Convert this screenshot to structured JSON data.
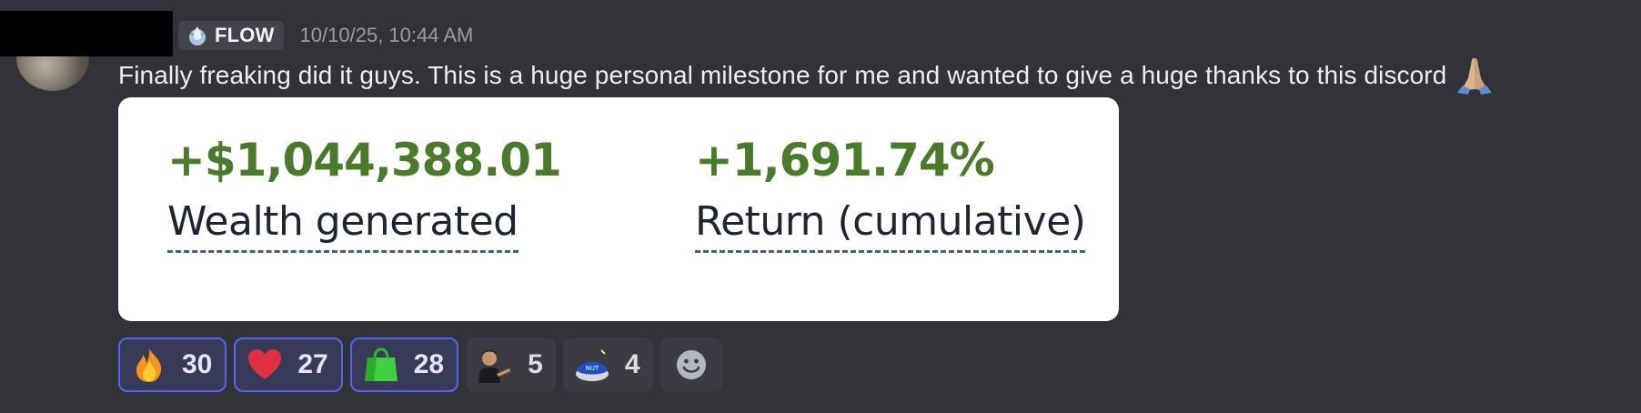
{
  "message": {
    "guild_tag": "FLOW",
    "timestamp": "10/10/25, 10:44 AM",
    "text": "Finally freaking did it guys.  This is a huge personal milestone for me and wanted to give a huge thanks to this discord",
    "trailing_emoji": "folded-hands-icon"
  },
  "card": {
    "left_value": "+$1,044,388.01",
    "left_label": "Wealth generated",
    "right_value": "+1,691.74%",
    "right_label": "Return (cumulative)",
    "value_color": "#4b7a2c"
  },
  "reactions": [
    {
      "emoji": "fire-icon",
      "count": "30",
      "active": true
    },
    {
      "emoji": "heart-icon",
      "count": "27",
      "active": true
    },
    {
      "emoji": "green-bag-icon",
      "count": "28",
      "active": true
    },
    {
      "emoji": "person-pointing-icon",
      "count": "5",
      "active": false
    },
    {
      "emoji": "nut-button-icon",
      "count": "4",
      "active": false
    }
  ],
  "colors": {
    "background": "#323339",
    "accent": "#5865f2"
  }
}
